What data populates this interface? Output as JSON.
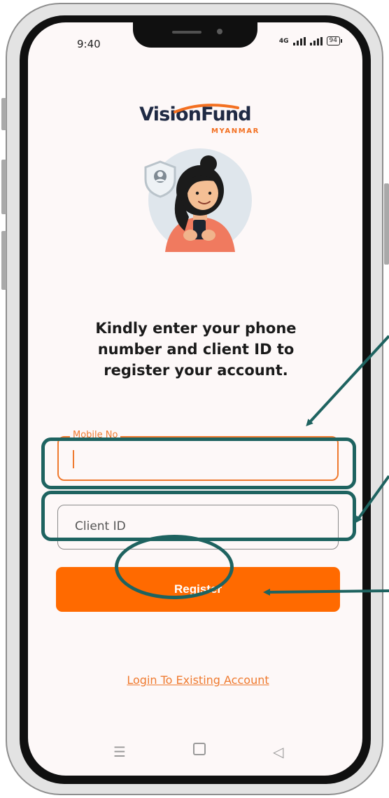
{
  "status_bar": {
    "time": "9:40",
    "network": "4G",
    "battery": "94"
  },
  "brand": {
    "name": "VisionFund",
    "region": "MYANMAR",
    "primary_color": "#f37021",
    "dark_color": "#1f2a44"
  },
  "headline": "Kindly enter your phone number  and client ID to register your account.",
  "form": {
    "mobile_label": "Mobile No",
    "mobile_value": "",
    "client_placeholder": "Client ID",
    "register_label": "Register"
  },
  "login_link": "Login To Existing Account",
  "annotation_color": "#1e6360",
  "nav_icons": [
    "menu-icon",
    "home-icon",
    "back-icon"
  ]
}
